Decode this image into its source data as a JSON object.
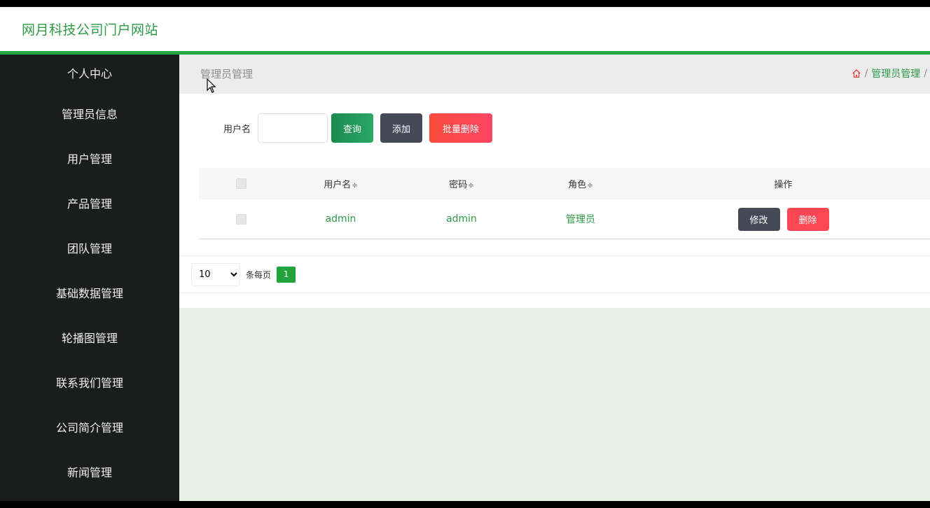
{
  "header": {
    "site_title": "网月科技公司门户网站"
  },
  "sidebar": {
    "items": [
      {
        "label": "个人中心"
      },
      {
        "label": "管理员信息"
      },
      {
        "label": "用户管理"
      },
      {
        "label": "产品管理"
      },
      {
        "label": "团队管理"
      },
      {
        "label": "基础数据管理"
      },
      {
        "label": "轮播图管理"
      },
      {
        "label": "联系我们管理"
      },
      {
        "label": "公司简介管理"
      },
      {
        "label": "新闻管理"
      }
    ]
  },
  "page": {
    "title": "管理员管理",
    "breadcrumb": {
      "separator": "/",
      "current": "管理员管理",
      "home_icon": "home-icon"
    }
  },
  "search": {
    "label": "用户名",
    "value": "",
    "placeholder": "",
    "query_button": "查询",
    "add_button": "添加",
    "batch_delete_button": "批量删除"
  },
  "table": {
    "headers": {
      "username": "用户名",
      "password": "密码",
      "role": "角色",
      "operation": "操作",
      "sort_symbol": "≑"
    },
    "rows": [
      {
        "username": "admin",
        "password": "admin",
        "role": "管理员",
        "edit": "修改",
        "delete": "删除"
      }
    ]
  },
  "pagination": {
    "page_size": "10",
    "page_size_options": [
      "10"
    ],
    "per_page_label": "条每页",
    "current_page": "1"
  },
  "colors": {
    "brand": "#2e9a46",
    "sidebar_bg": "#1b1d1c",
    "danger": "#fc4653",
    "dark_button": "#464a58"
  }
}
